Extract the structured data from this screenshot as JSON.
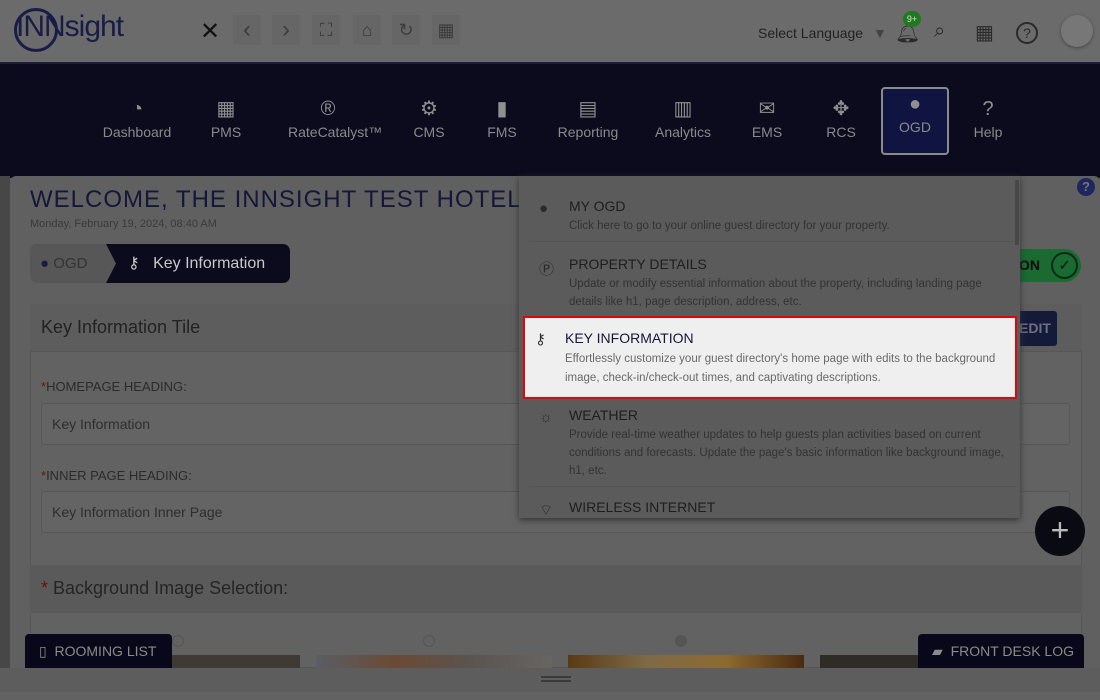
{
  "app": {
    "logo": "INNsight"
  },
  "toolbar": {
    "close": "✕",
    "back": "‹",
    "forward": "›",
    "fullscreen": "⛶",
    "home": "⌂",
    "refresh": "↻",
    "apps": "▦",
    "language": "Select Language",
    "language_caret": "▼",
    "notification_badge": "9+"
  },
  "nav": {
    "items": [
      {
        "label": "Dashboard",
        "icon": "◔"
      },
      {
        "label": "PMS",
        "icon": "▦"
      },
      {
        "label": "RateCatalyst™",
        "icon": "®"
      },
      {
        "label": "CMS",
        "icon": "⚙"
      },
      {
        "label": "FMS",
        "icon": "▮"
      },
      {
        "label": "Reporting",
        "icon": "▤"
      },
      {
        "label": "Analytics",
        "icon": "▥"
      },
      {
        "label": "EMS",
        "icon": "✉"
      },
      {
        "label": "RCS",
        "icon": "✥"
      },
      {
        "label": "OGD",
        "icon": "●",
        "active": true
      },
      {
        "label": "Help",
        "icon": "?"
      }
    ]
  },
  "page": {
    "welcome": "WELCOME, THE INNSIGHT TEST HOTEL",
    "date": "Monday, February 19, 2024, 08:40 AM",
    "breadcrumb": [
      "OGD",
      "Key Information"
    ],
    "toggle_label": "ON",
    "edit_label": "EDIT"
  },
  "form": {
    "tile_title": "Key Information Tile",
    "homepage_label": "HOMEPAGE HEADING:",
    "homepage_value": "Key Information",
    "inner_label": "INNER PAGE HEADING:",
    "inner_value": "Key Information Inner Page",
    "required": "*",
    "bg_title": "Background Image Selection:"
  },
  "dropdown": {
    "items": [
      {
        "title": "MY OGD",
        "desc": "Click here to go to your online guest directory for your property."
      },
      {
        "title": "PROPERTY DETAILS",
        "desc": "Update or modify essential information about the property, including landing page details like h1, page description, address, etc."
      },
      {
        "title": "KEY INFORMATION",
        "desc": "Effortlessly customize your guest directory's home page with edits to the background image, check-in/check-out times, and captivating descriptions."
      },
      {
        "title": "WEATHER",
        "desc": "Provide real-time weather updates to help guests plan activities based on current conditions and forecasts. Update the page's basic information like background image, h1, etc."
      },
      {
        "title": "WIRELESS INTERNET",
        "desc": ""
      }
    ]
  },
  "buttons": {
    "rooming_list": "ROOMING LIST",
    "front_desk_log": "FRONT DESK LOG",
    "add": "+"
  },
  "colors": {
    "highlight_border": "#e0060c",
    "nav_bg": "#0b0b1d",
    "toggle_on": "#1a6a32"
  }
}
